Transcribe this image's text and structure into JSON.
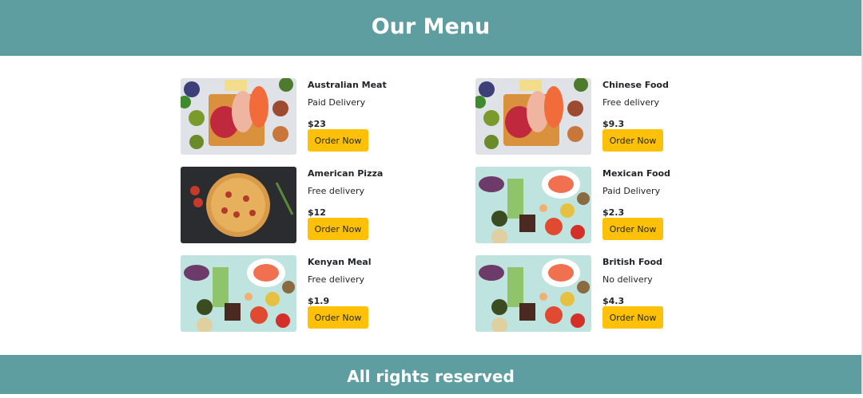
{
  "header": {
    "title": "Our Menu"
  },
  "footer": {
    "text": "All rights reserved"
  },
  "items": [
    {
      "name": "Australian Meat",
      "delivery": "Paid Delivery",
      "price": "$23",
      "button": "Order Now",
      "image": "meat"
    },
    {
      "name": "Chinese Food",
      "delivery": "Free delivery",
      "price": "$9.3",
      "button": "Order Now",
      "image": "meat"
    },
    {
      "name": "American Pizza",
      "delivery": "Free delivery",
      "price": "$12",
      "button": "Order Now",
      "image": "pizza"
    },
    {
      "name": "Mexican Food",
      "delivery": "Paid Delivery",
      "price": "$2.3",
      "button": "Order Now",
      "image": "healthy"
    },
    {
      "name": "Kenyan Meal",
      "delivery": "Free delivery",
      "price": "$1.9",
      "button": "Order Now",
      "image": "healthy"
    },
    {
      "name": "British Food",
      "delivery": "No delivery",
      "price": "$4.3",
      "button": "Order Now",
      "image": "healthy"
    }
  ]
}
